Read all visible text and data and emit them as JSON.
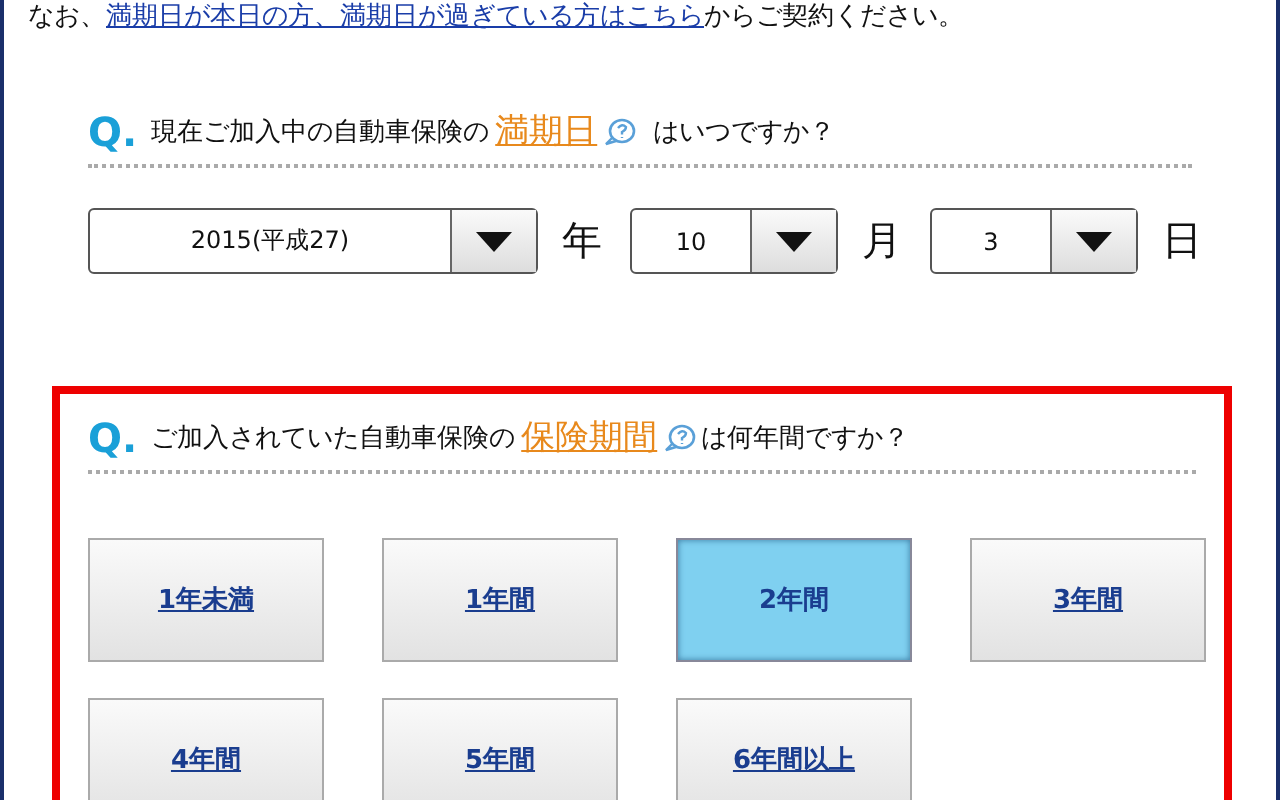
{
  "notice": {
    "prefix": "なお、",
    "link": "満期日が本日の方、満期日が過ぎている方はこちら",
    "suffix": "からご契約ください。"
  },
  "question_1": {
    "mark": "Q.",
    "before": "現在ご加入中の自動車保険の",
    "term": "満期日",
    "after": "はいつですか？"
  },
  "date": [
    {
      "value": "2015(平成27)",
      "unit": "年",
      "kind": "wide"
    },
    {
      "value": "10",
      "unit": "月",
      "kind": "narrow"
    },
    {
      "value": "3",
      "unit": "日",
      "kind": "narrow"
    }
  ],
  "question_2": {
    "mark": "Q.",
    "before": "ご加入されていた自動車保険の",
    "term": "保険期間",
    "after": "は何年間ですか？"
  },
  "options": [
    {
      "label": "1年未満",
      "selected": false
    },
    {
      "label": "1年間",
      "selected": false
    },
    {
      "label": "2年間",
      "selected": true
    },
    {
      "label": "3年間",
      "selected": false
    },
    {
      "label": "4年間",
      "selected": false
    },
    {
      "label": "5年間",
      "selected": false
    },
    {
      "label": "6年間以上",
      "selected": false
    }
  ]
}
